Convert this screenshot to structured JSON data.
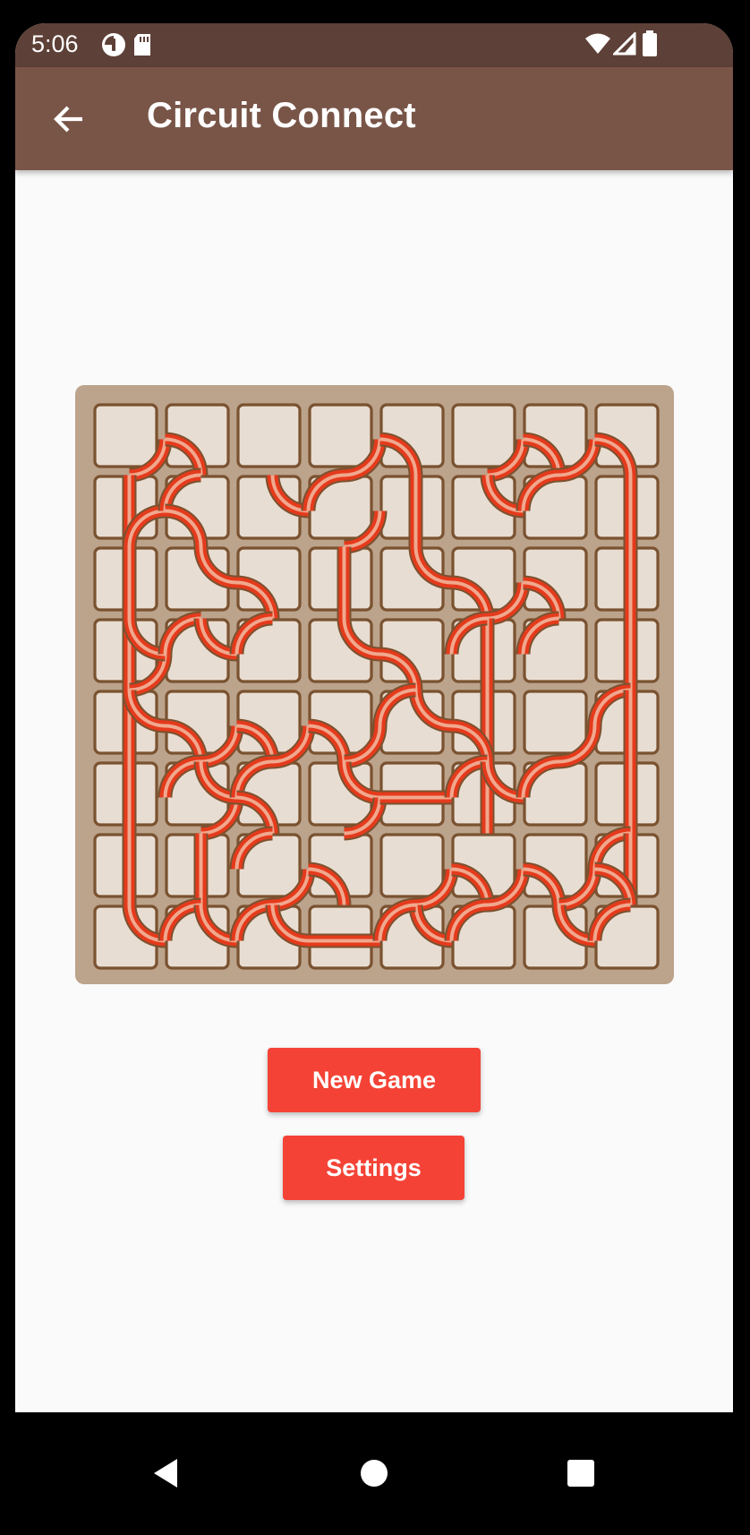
{
  "status_bar": {
    "time": "5:06",
    "left_icons": [
      "pie-timer-icon",
      "sd-card-icon"
    ],
    "right_icons": [
      "wifi-icon",
      "cell-signal-icon",
      "battery-icon"
    ]
  },
  "app_bar": {
    "title": "Circuit Connect",
    "back_icon": "arrow-left-icon"
  },
  "board": {
    "rows": 8,
    "cols": 8,
    "colors": {
      "board_bg": "#bca38c",
      "tile_fill": "#e8ddd2",
      "tile_border": "#7a5230",
      "wire_outer": "#e53a1c",
      "wire_inner": "#f0a88e"
    },
    "wire_rule": "Each tile lists the edge midpoints (n,e,s,w) that carry wire. Two edges per tile form a straight or a quarter-circle arc.",
    "tiles": [
      [
        [
          "s",
          "e"
        ],
        [
          "s",
          "w"
        ],
        [],
        [
          "s",
          "e"
        ],
        [
          "s",
          "w"
        ],
        [
          "s",
          "e"
        ],
        [
          "s",
          "w",
          "s",
          "e"
        ],
        [
          "s",
          "w"
        ]
      ],
      [
        [
          "n",
          "s",
          "e",
          "s"
        ],
        [
          "n",
          "w",
          "s",
          "w"
        ],
        [
          "n",
          "e"
        ],
        [
          "n",
          "w",
          "s",
          "e"
        ],
        [
          "n",
          "s"
        ],
        [
          "n",
          "e"
        ],
        [
          "n",
          "w"
        ],
        [
          "n",
          "s"
        ]
      ],
      [
        [
          "n",
          "s"
        ],
        [
          "n",
          "e"
        ],
        [
          "s",
          "w"
        ],
        [
          "n",
          "s"
        ],
        [
          "n",
          "e"
        ],
        [
          "s",
          "w",
          "s",
          "e"
        ],
        [
          "s",
          "w"
        ],
        [
          "n",
          "s"
        ]
      ],
      [
        [
          "n",
          "s",
          "s",
          "e",
          "n",
          "e"
        ],
        [
          "n",
          "w",
          "n",
          "e"
        ],
        [
          "n",
          "w"
        ],
        [
          "n",
          "e"
        ],
        [
          "s",
          "w"
        ],
        [
          "n",
          "s",
          "n",
          "w"
        ],
        [
          "n",
          "w"
        ],
        [
          "n",
          "s"
        ]
      ],
      [
        [
          "n",
          "s",
          "n",
          "e"
        ],
        [
          "s",
          "w",
          "s",
          "e"
        ],
        [
          "s",
          "w",
          "s",
          "e"
        ],
        [
          "s",
          "w",
          "s",
          "e"
        ],
        [
          "n",
          "e",
          "n",
          "w"
        ],
        [
          "n",
          "s",
          "s",
          "w"
        ],
        [
          "s",
          "e"
        ],
        [
          "n",
          "w",
          "n",
          "s"
        ]
      ],
      [
        [
          "n",
          "s"
        ],
        [
          "n",
          "w",
          "s",
          "e",
          "n",
          "e"
        ],
        [
          "n",
          "w",
          "s",
          "w"
        ],
        [
          "n",
          "e",
          "s",
          "e"
        ],
        [
          "e",
          "w"
        ],
        [
          "n",
          "s",
          "n",
          "w",
          "n",
          "e"
        ],
        [
          "n",
          "w"
        ],
        [
          "n",
          "s"
        ]
      ],
      [
        [
          "n",
          "s"
        ],
        [
          "n",
          "s"
        ],
        [
          "n",
          "w",
          "s",
          "e"
        ],
        [
          "s",
          "w"
        ],
        [
          "s",
          "e"
        ],
        [
          "s",
          "w",
          "s",
          "e"
        ],
        [
          "s",
          "w",
          "s",
          "e"
        ],
        [
          "n",
          "w",
          "n",
          "s",
          "s",
          "w"
        ]
      ],
      [
        [
          "n",
          "e"
        ],
        [
          "n",
          "w",
          "n",
          "e"
        ],
        [
          "n",
          "w",
          "n",
          "e"
        ],
        [
          "e",
          "w"
        ],
        [
          "n",
          "e",
          "n",
          "w"
        ],
        [
          "n",
          "w"
        ],
        [
          "n",
          "e"
        ],
        [
          "n",
          "w"
        ]
      ]
    ]
  },
  "buttons": {
    "new_game": "New Game",
    "settings": "Settings"
  },
  "nav_bar": {
    "back_icon": "nav-back-triangle-icon",
    "home_icon": "nav-home-circle-icon",
    "recents_icon": "nav-recents-square-icon"
  }
}
